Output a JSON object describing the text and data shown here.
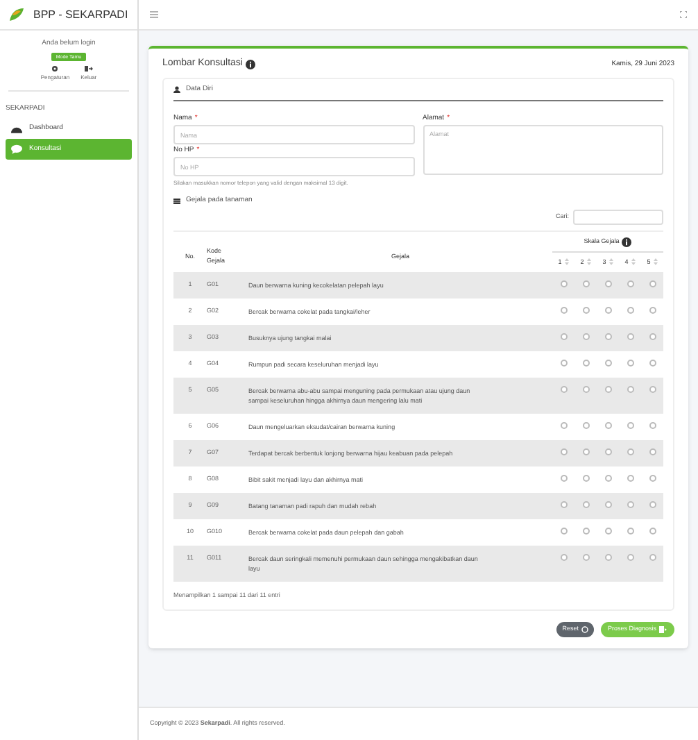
{
  "sidebar": {
    "brand": "BPP - SEKARPADI",
    "login_status": "Anda belum login",
    "mode_badge": "Mode Tamu",
    "actions": [
      {
        "kind": "settings",
        "label": "Pengaturan"
      },
      {
        "kind": "logout",
        "label": "Keluar"
      }
    ],
    "section": "SEKARPADI",
    "items": [
      {
        "kind": "dashboard",
        "label": "Dashboard",
        "selected": false
      },
      {
        "kind": "chat",
        "label": "Konsultasi",
        "selected": true
      }
    ]
  },
  "card": {
    "title": "Lombar Konsultasi",
    "date": "Kamis, 29 Juni 2023",
    "personal": {
      "heading": "Data Diri",
      "fields": [
        {
          "label": "Nama",
          "required_mark": "*",
          "placeholder": "Nama"
        },
        {
          "label": "No HP",
          "required_mark": "*",
          "placeholder": "No HP",
          "help": "Silakan masukkan nomor telepon yang valid dengan maksimal 13 digit."
        }
      ],
      "address": {
        "label": "Alamat",
        "required_mark": "*",
        "placeholder": "Alamat"
      }
    },
    "symptoms": {
      "heading": "Gejala pada tanaman",
      "search_label": "Cari:",
      "columns": [
        "No.",
        "Kode Gejala",
        "Gejala"
      ],
      "scale_heading": "Skala Gejala",
      "scale_columns": [
        "1",
        "2",
        "3",
        "4",
        "5"
      ],
      "rows": [
        {
          "no": "1",
          "code": "G01",
          "text": "Daun berwarna kuning kecokelatan pelepah layu",
          "scale": [
            false,
            false,
            false,
            false,
            false
          ]
        },
        {
          "no": "2",
          "code": "G02",
          "text": "Bercak berwarna cokelat pada tangkai/leher",
          "scale": [
            false,
            false,
            false,
            false,
            false
          ]
        },
        {
          "no": "3",
          "code": "G03",
          "text": "Busuknya ujung tangkai malai",
          "scale": [
            false,
            false,
            false,
            false,
            false
          ]
        },
        {
          "no": "4",
          "code": "G04",
          "text": "Rumpun padi secara keseluruhan menjadi layu",
          "scale": [
            false,
            false,
            false,
            false,
            false
          ]
        },
        {
          "no": "5",
          "code": "G05",
          "text": "Bercak berwarna abu-abu sampai menguning pada permukaan atau ujung daun sampai keseluruhan hingga akhirnya daun mengering lalu mati",
          "scale": [
            false,
            false,
            false,
            false,
            false
          ]
        },
        {
          "no": "6",
          "code": "G06",
          "text": "Daun mengeluarkan eksudat/cairan berwarna kuning",
          "scale": [
            false,
            false,
            false,
            false,
            false
          ]
        },
        {
          "no": "7",
          "code": "G07",
          "text": "Terdapat bercak berbentuk lonjong berwarna hijau keabuan pada pelepah",
          "scale": [
            false,
            false,
            false,
            false,
            false
          ]
        },
        {
          "no": "8",
          "code": "G08",
          "text": "Bibit sakit menjadi layu dan akhirnya mati",
          "scale": [
            false,
            false,
            false,
            false,
            false
          ]
        },
        {
          "no": "9",
          "code": "G09",
          "text": "Batang tanaman padi rapuh dan mudah rebah",
          "scale": [
            false,
            false,
            false,
            false,
            false
          ]
        },
        {
          "no": "10",
          "code": "G010",
          "text": "Bercak berwarna cokelat pada daun pelepah dan gabah",
          "scale": [
            false,
            false,
            false,
            false,
            false
          ]
        },
        {
          "no": "11",
          "code": "G011",
          "text": "Bercak daun seringkali memenuhi permukaan daun sehingga mengakibatkan daun layu",
          "scale": [
            false,
            false,
            false,
            false,
            false
          ]
        }
      ],
      "info": "Menampilkan 1 sampai 11 dari 11 entri"
    },
    "buttons": [
      {
        "kind": "reset",
        "label": "Reset"
      },
      {
        "kind": "submit",
        "label": "Proses Diagnosis"
      }
    ]
  },
  "footer": "Copyright © 2023 **Sekarpadi**. All rights reserved."
}
